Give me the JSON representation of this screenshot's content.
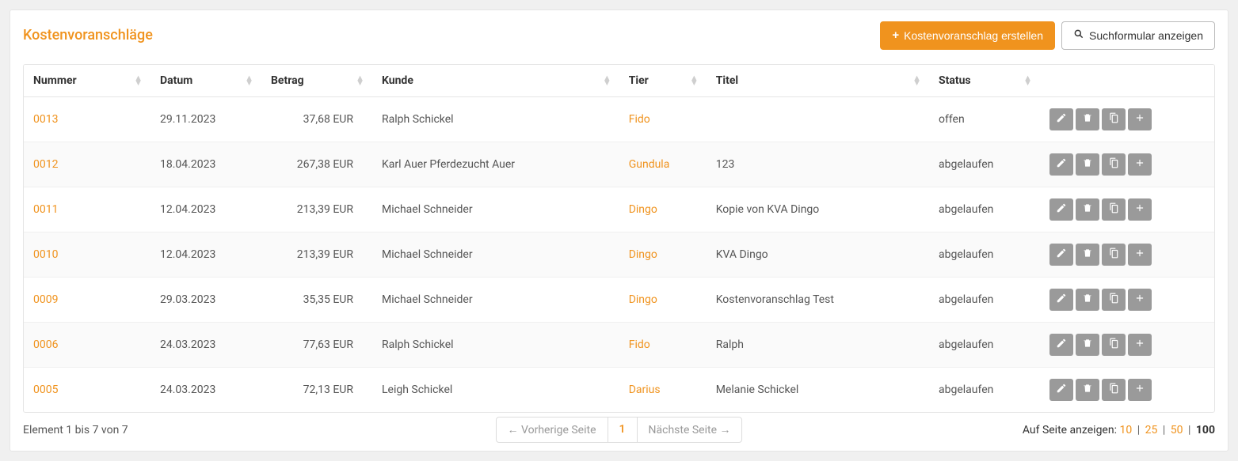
{
  "title": "Kostenvoranschläge",
  "header": {
    "create_label": "Kostenvoranschlag erstellen",
    "search_label": "Suchformular anzeigen"
  },
  "columns": {
    "nummer": "Nummer",
    "datum": "Datum",
    "betrag": "Betrag",
    "kunde": "Kunde",
    "tier": "Tier",
    "titel": "Titel",
    "status": "Status"
  },
  "rows": [
    {
      "nummer": "0013",
      "datum": "29.11.2023",
      "betrag": "37,68 EUR",
      "kunde": "Ralph Schickel",
      "tier": "Fido",
      "titel": "",
      "status": "offen"
    },
    {
      "nummer": "0012",
      "datum": "18.04.2023",
      "betrag": "267,38 EUR",
      "kunde": "Karl Auer Pferdezucht Auer",
      "tier": "Gundula",
      "titel": "123",
      "status": "abgelaufen"
    },
    {
      "nummer": "0011",
      "datum": "12.04.2023",
      "betrag": "213,39 EUR",
      "kunde": "Michael Schneider",
      "tier": "Dingo",
      "titel": "Kopie von KVA Dingo",
      "status": "abgelaufen"
    },
    {
      "nummer": "0010",
      "datum": "12.04.2023",
      "betrag": "213,39 EUR",
      "kunde": "Michael Schneider",
      "tier": "Dingo",
      "titel": "KVA Dingo",
      "status": "abgelaufen"
    },
    {
      "nummer": "0009",
      "datum": "29.03.2023",
      "betrag": "35,35 EUR",
      "kunde": "Michael Schneider",
      "tier": "Dingo",
      "titel": "Kostenvoranschlag Test",
      "status": "abgelaufen"
    },
    {
      "nummer": "0006",
      "datum": "24.03.2023",
      "betrag": "77,63 EUR",
      "kunde": "Ralph Schickel",
      "tier": "Fido",
      "titel": "Ralph",
      "status": "abgelaufen"
    },
    {
      "nummer": "0005",
      "datum": "24.03.2023",
      "betrag": "72,13 EUR",
      "kunde": "Leigh Schickel",
      "tier": "Darius",
      "titel": "Melanie Schickel",
      "status": "abgelaufen"
    }
  ],
  "footer": {
    "summary": "Element 1 bis 7 von 7",
    "prev": "← Vorherige Seite",
    "current_page": "1",
    "next": "Nächste Seite →",
    "per_page_label": "Auf Seite anzeigen:",
    "opts": {
      "o10": "10",
      "o25": "25",
      "o50": "50",
      "o100": "100"
    }
  }
}
